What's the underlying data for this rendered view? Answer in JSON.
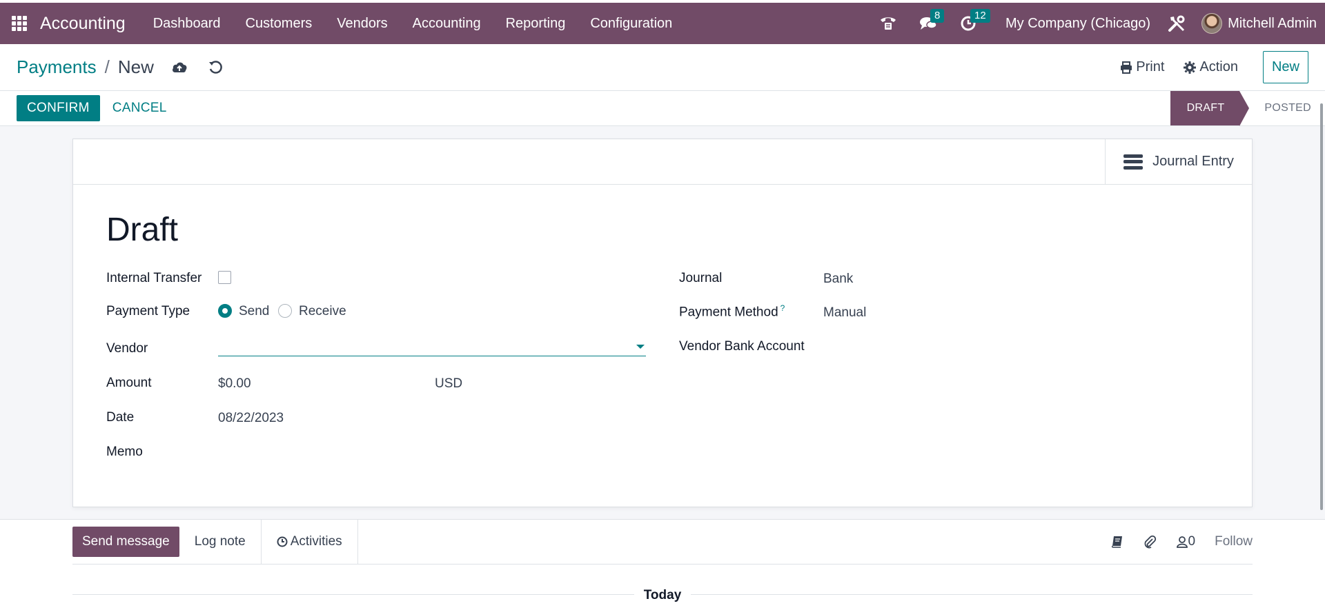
{
  "app": {
    "title": "Accounting"
  },
  "nav": {
    "items": [
      "Dashboard",
      "Customers",
      "Vendors",
      "Accounting",
      "Reporting",
      "Configuration"
    ],
    "messages_count": "8",
    "activities_count": "12",
    "company": "My Company (Chicago)",
    "user": "Mitchell Admin"
  },
  "breadcrumb": {
    "parent": "Payments",
    "separator": "/",
    "current": "New"
  },
  "control": {
    "print_label": "Print",
    "action_label": "Action",
    "new_label": "New"
  },
  "statusbar": {
    "confirm_label": "CONFIRM",
    "cancel_label": "CANCEL",
    "stages": [
      "DRAFT",
      "POSTED"
    ],
    "active_stage": "DRAFT"
  },
  "form": {
    "stat_button_label": "Journal Entry",
    "title": "Draft",
    "internal_transfer_label": "Internal Transfer",
    "internal_transfer_checked": false,
    "payment_type_label": "Payment Type",
    "payment_type_options": [
      "Send",
      "Receive"
    ],
    "payment_type_selected": "Send",
    "vendor_label": "Vendor",
    "vendor_value": "",
    "amount_label": "Amount",
    "amount_value": "$0.00",
    "currency_value": "USD",
    "date_label": "Date",
    "date_value": "08/22/2023",
    "memo_label": "Memo",
    "journal_label": "Journal",
    "journal_value": "Bank",
    "payment_method_label": "Payment Method",
    "payment_method_help": "?",
    "payment_method_value": "Manual",
    "vendor_bank_label": "Vendor Bank Account"
  },
  "chatter": {
    "send_message_label": "Send message",
    "log_note_label": "Log note",
    "activities_label": "Activities",
    "followers_count": "0",
    "follow_label": "Follow",
    "today_label": "Today"
  },
  "colors": {
    "brand": "#714b67",
    "accent": "#017e84",
    "bg": "#f5f6f9"
  }
}
